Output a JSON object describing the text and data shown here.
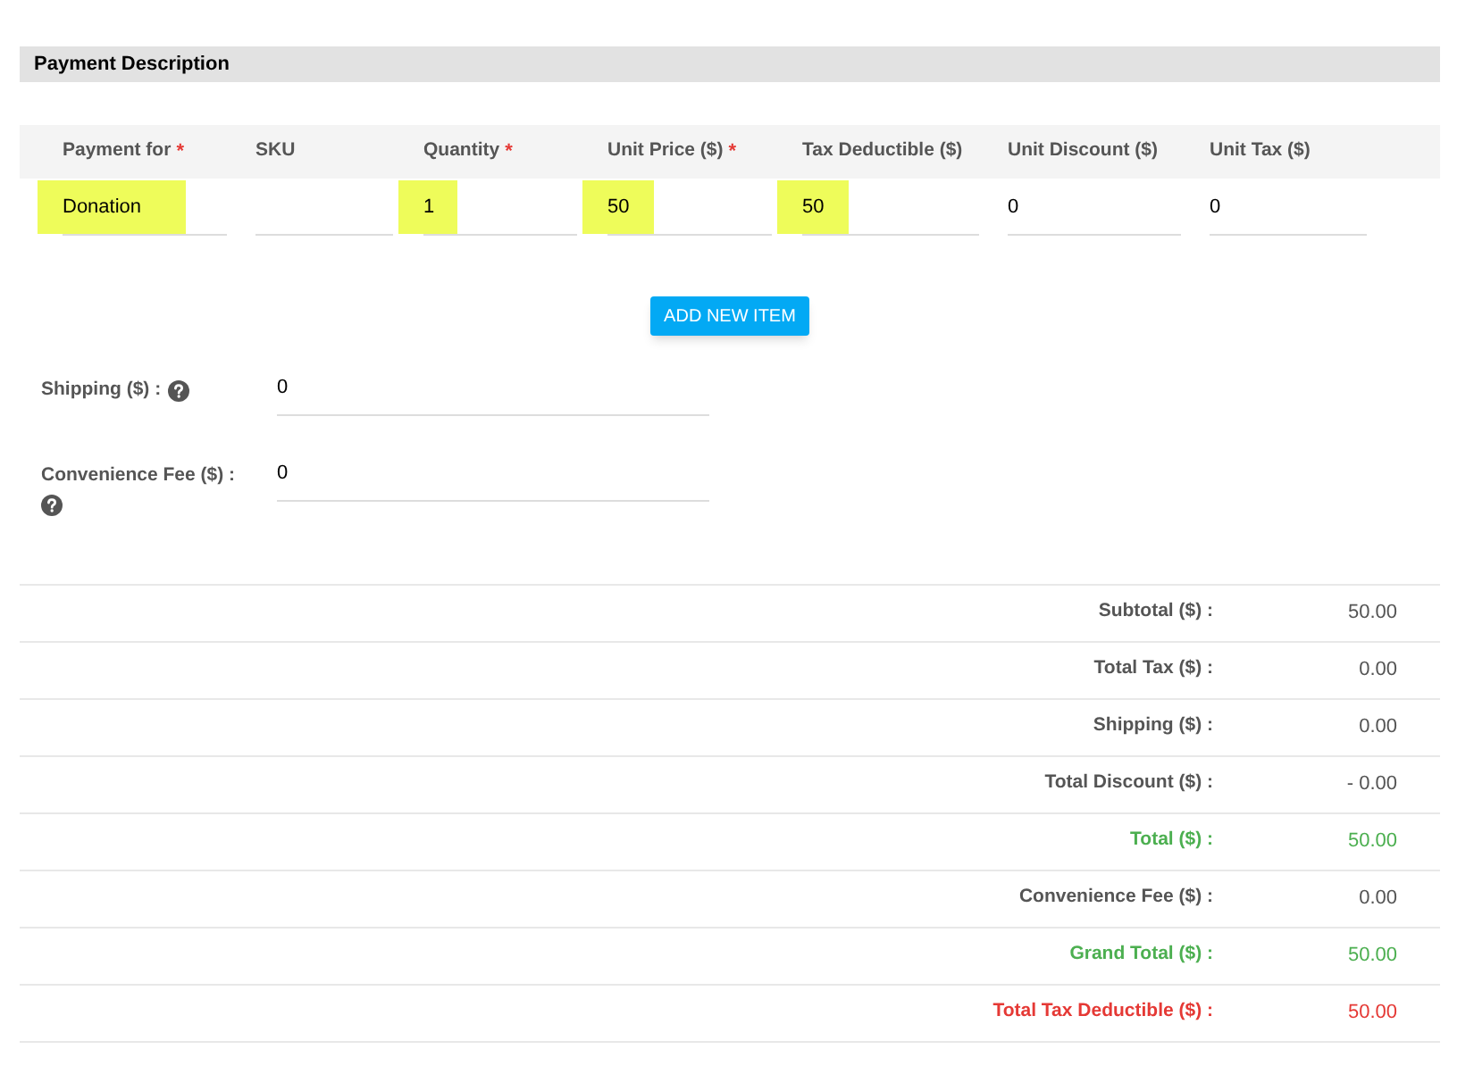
{
  "section": {
    "title": "Payment Description"
  },
  "items": {
    "columns": [
      {
        "label": "Payment for",
        "marker": "*"
      },
      {
        "label": "SKU"
      },
      {
        "label": "Quantity",
        "marker": "*"
      },
      {
        "label": "Unit Price ($)",
        "marker": "*"
      },
      {
        "label": "Tax Deductible ($)"
      },
      {
        "label": "Unit Discount ($)"
      },
      {
        "label": "Unit Tax ($)"
      }
    ],
    "row": [
      {
        "value": "Donation",
        "highlighted": true
      },
      {
        "highlighted": false
      },
      {
        "value": "1",
        "highlighted": true
      },
      {
        "value": "50",
        "highlighted": true
      },
      {
        "value": "50",
        "highlighted": true
      },
      {
        "value": "0",
        "highlighted": false
      },
      {
        "value": "0",
        "highlighted": false
      }
    ]
  },
  "add_button": "ADD NEW ITEM",
  "fees": [
    {
      "label": "Shipping ($) :",
      "value": "0",
      "help_inline": true
    },
    {
      "label": "Convenience Fee ($) :",
      "value": "0",
      "help_inline": false
    }
  ],
  "summary": [
    {
      "label": "Subtotal ($) :",
      "value": "50.00",
      "color": "#555555"
    },
    {
      "label": "Total Tax ($) :",
      "value": "0.00",
      "color": "#555555"
    },
    {
      "label": "Shipping ($) :",
      "value": "0.00",
      "color": "#555555"
    },
    {
      "label": "Total Discount ($) :",
      "value": "- 0.00",
      "color": "#555555"
    },
    {
      "label": "Total ($) :",
      "value": "50.00",
      "color": "#4caf50"
    },
    {
      "label": "Convenience Fee ($) :",
      "value": "0.00",
      "color": "#555555"
    },
    {
      "label": "Grand Total ($) :",
      "value": "50.00",
      "color": "#4caf50"
    },
    {
      "label": "Total Tax Deductible ($) :",
      "value": "50.00",
      "color": "#e53935"
    }
  ]
}
